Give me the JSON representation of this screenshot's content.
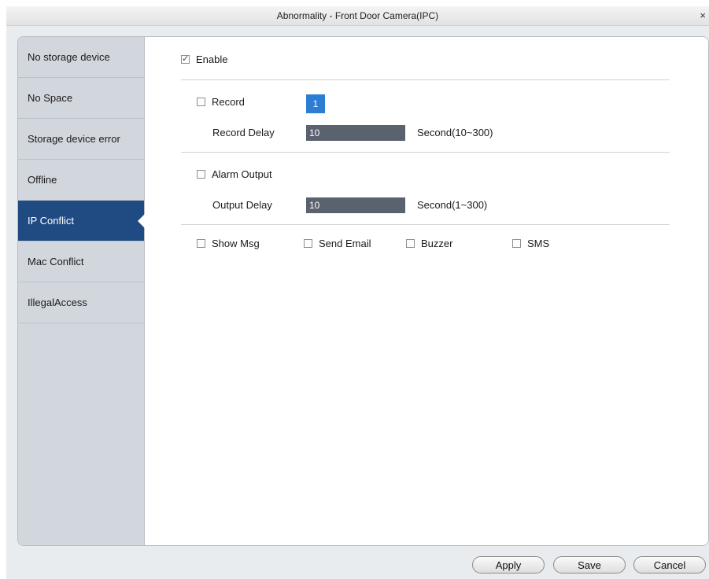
{
  "window": {
    "title": "Abnormality - Front Door Camera(IPC)",
    "close_glyph": "×"
  },
  "sidebar": {
    "items": [
      {
        "label": "No storage device"
      },
      {
        "label": "No Space"
      },
      {
        "label": "Storage device error"
      },
      {
        "label": "Offline"
      },
      {
        "label": "IP Conflict",
        "active": true
      },
      {
        "label": "Mac Conflict"
      },
      {
        "label": "IllegalAccess"
      }
    ]
  },
  "content": {
    "enable": {
      "label": "Enable",
      "checked": true
    },
    "record": {
      "label": "Record",
      "checked": false,
      "channel": "1"
    },
    "record_delay": {
      "label": "Record Delay",
      "value": "10",
      "unit": "Second(10~300)"
    },
    "alarm_output": {
      "label": "Alarm Output",
      "checked": false
    },
    "output_delay": {
      "label": "Output Delay",
      "value": "10",
      "unit": "Second(1~300)"
    },
    "options": {
      "show_msg": {
        "label": "Show Msg",
        "checked": false
      },
      "send_email": {
        "label": "Send Email",
        "checked": false
      },
      "buzzer": {
        "label": "Buzzer",
        "checked": false
      },
      "sms": {
        "label": "SMS",
        "checked": false
      }
    }
  },
  "footer": {
    "apply": "Apply",
    "save": "Save",
    "cancel": "Cancel"
  },
  "colors": {
    "active_item": "#204b82",
    "badge": "#2d7dd2",
    "input_bg": "#5a6270"
  }
}
